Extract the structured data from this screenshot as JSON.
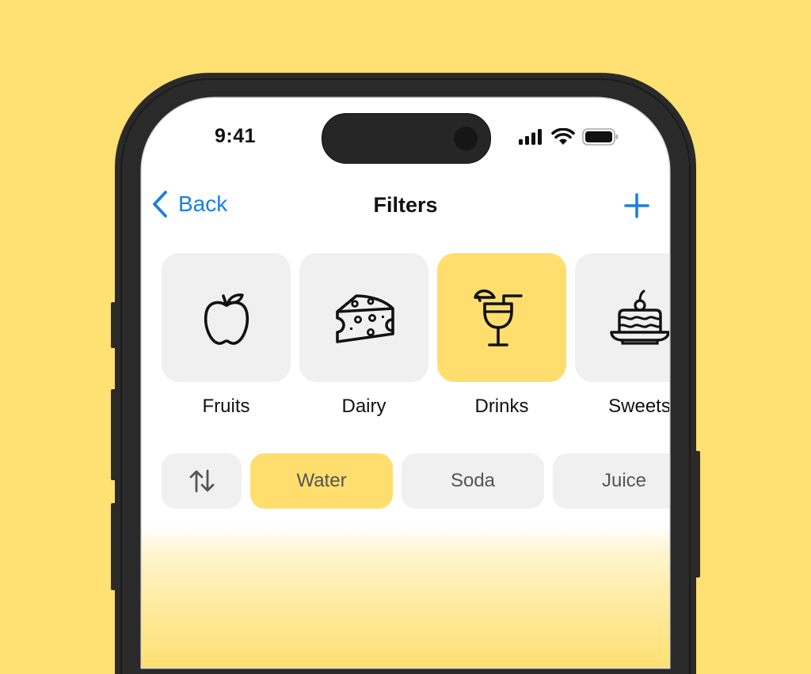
{
  "colors": {
    "background": "#FFE072",
    "accent": "#1a7fe6",
    "selected": "#FFDE6E",
    "tile": "#f0f0f0"
  },
  "status_bar": {
    "time": "9:41",
    "icons": [
      "signal-icon",
      "wifi-icon",
      "battery-icon"
    ]
  },
  "nav": {
    "back_label": "Back",
    "title": "Filters",
    "add_icon": "plus-icon"
  },
  "categories": [
    {
      "label": "Fruits",
      "icon": "apple-icon",
      "selected": false
    },
    {
      "label": "Dairy",
      "icon": "cheese-icon",
      "selected": false
    },
    {
      "label": "Drinks",
      "icon": "cocktail-icon",
      "selected": true
    },
    {
      "label": "Sweets",
      "icon": "cake-icon",
      "selected": false
    }
  ],
  "chips": {
    "sort_icon": "sort-arrows-icon",
    "options": [
      {
        "label": "Water",
        "selected": true
      },
      {
        "label": "Soda",
        "selected": false
      },
      {
        "label": "Juice",
        "selected": false
      }
    ]
  }
}
